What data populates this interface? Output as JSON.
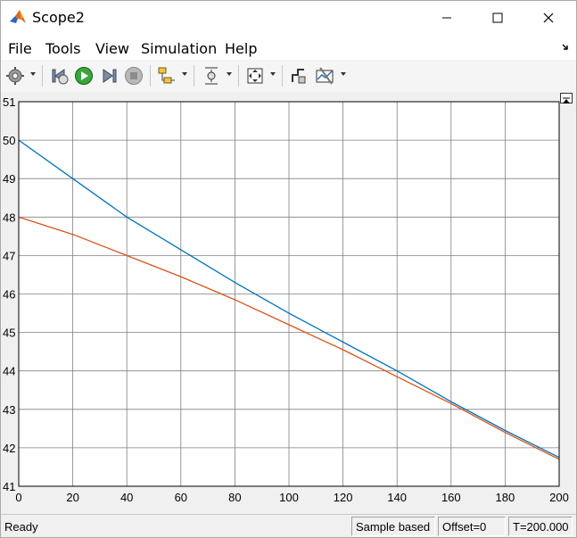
{
  "window": {
    "title": "Scope2"
  },
  "menu": {
    "items": [
      "File",
      "Tools",
      "View",
      "Simulation",
      "Help"
    ]
  },
  "toolbar": {
    "icons": [
      "gear-icon",
      "step-back-icon",
      "run-icon",
      "step-forward-icon",
      "stop-icon",
      "signal-select-icon",
      "triggers-icon",
      "zoom-fit-icon",
      "highlight-icon",
      "measurements-icon"
    ]
  },
  "colors": {
    "series1": "#0072bd",
    "series2": "#d95319",
    "plot_background": "#ffffff",
    "grid": "#808080"
  },
  "chart_data": {
    "type": "line",
    "title": "",
    "xlabel": "",
    "ylabel": "",
    "xlim": [
      0,
      200
    ],
    "ylim": [
      41,
      51
    ],
    "xticks": [
      "0",
      "20",
      "40",
      "60",
      "80",
      "100",
      "120",
      "140",
      "160",
      "180",
      "200"
    ],
    "yticks": [
      "41",
      "42",
      "43",
      "44",
      "45",
      "46",
      "47",
      "48",
      "49",
      "50",
      "51"
    ],
    "grid": true,
    "series": [
      {
        "color": "#0072bd",
        "x": [
          0,
          20,
          40,
          60,
          80,
          100,
          120,
          140,
          160,
          180,
          200
        ],
        "y": [
          50.0,
          49.0,
          48.0,
          47.15,
          46.3,
          45.5,
          44.75,
          44.0,
          43.2,
          42.45,
          41.75
        ]
      },
      {
        "color": "#d95319",
        "x": [
          0,
          20,
          40,
          60,
          80,
          100,
          120,
          140,
          160,
          180,
          200
        ],
        "y": [
          48.0,
          47.55,
          47.0,
          46.45,
          45.85,
          45.2,
          44.55,
          43.85,
          43.15,
          42.4,
          41.7
        ]
      }
    ]
  },
  "status": {
    "ready": "Ready",
    "sample_mode": "Sample based",
    "offset": "Offset=0",
    "time": "T=200.000"
  }
}
